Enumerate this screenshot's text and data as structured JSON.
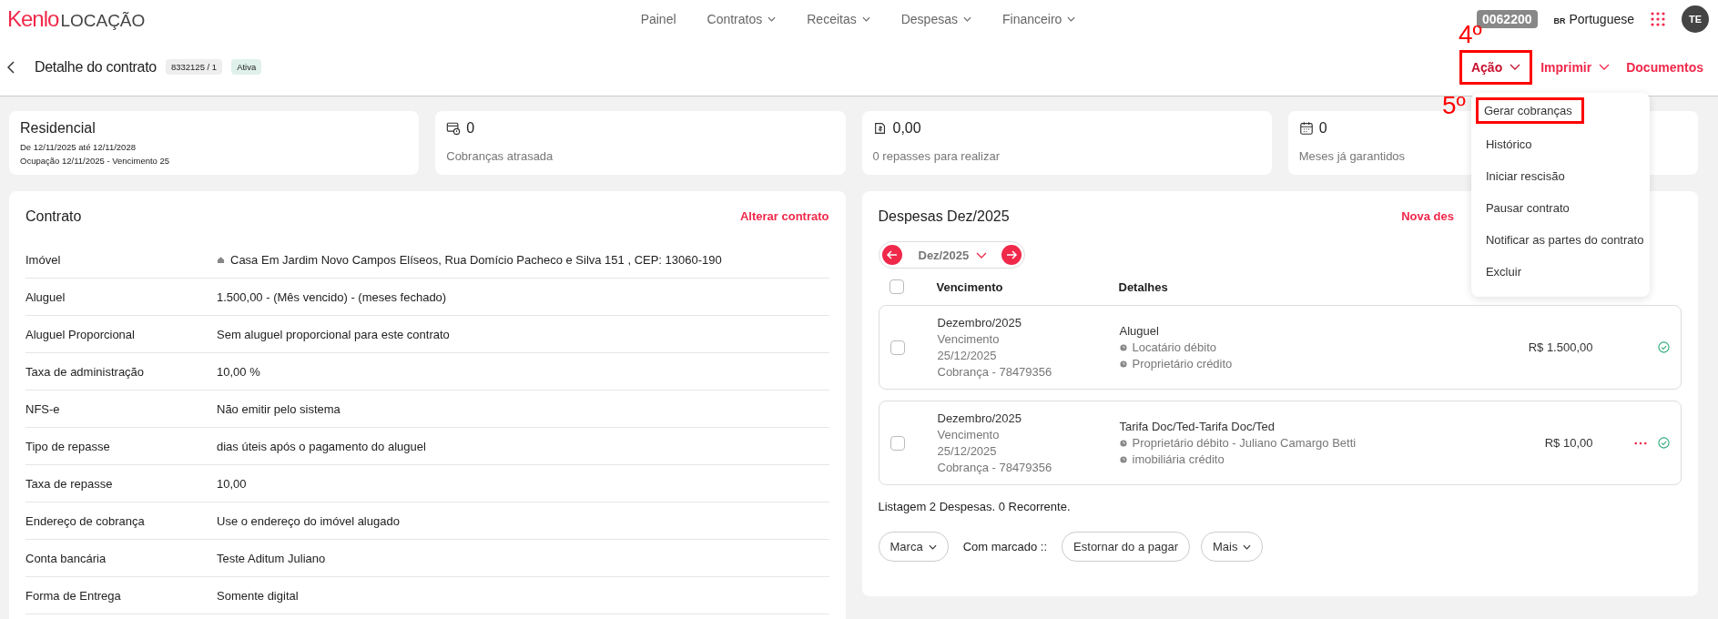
{
  "brand": {
    "logo": "Kenlo",
    "product": "LOCAÇÃO"
  },
  "nav": [
    {
      "label": "Painel",
      "dropdown": false
    },
    {
      "label": "Contratos",
      "dropdown": true
    },
    {
      "label": "Receitas",
      "dropdown": true
    },
    {
      "label": "Despesas",
      "dropdown": true
    },
    {
      "label": "Financeiro",
      "dropdown": true
    }
  ],
  "account": {
    "code": "0062200",
    "language_flag": "BR",
    "language": "Portuguese",
    "avatar": "TE"
  },
  "page": {
    "title": "Detalhe do contrato",
    "contract_id": "8332125 / 1",
    "status": "Ativa"
  },
  "actions": [
    {
      "label": "Ação",
      "dropdown": true,
      "expanded": true,
      "annotation": "4º"
    },
    {
      "label": "Imprimir",
      "dropdown": true,
      "expanded": false
    },
    {
      "label": "Documentos",
      "dropdown": false,
      "expanded": false
    }
  ],
  "action_menu": [
    {
      "label": "Gerar cobranças",
      "annotation": "5º"
    },
    {
      "label": "Histórico"
    },
    {
      "label": "Iniciar rescisão"
    },
    {
      "label": "Pausar contrato"
    },
    {
      "label": "Notificar as partes do contrato"
    },
    {
      "label": "Excluir"
    }
  ],
  "summary": {
    "type": {
      "title": "Residencial",
      "period": "De 12/11/2025 até 12/11/2028",
      "occupancy": "Ocupação 12/11/2025 - Vencimento 25"
    },
    "stats": [
      {
        "kind": "overdue",
        "value": "0",
        "label": "Cobranças atrasada"
      },
      {
        "kind": "transfer",
        "value": "0,00",
        "label": "0 repasses para realizar"
      },
      {
        "kind": "calendar",
        "value": "0",
        "label": "Meses já garantidos"
      }
    ]
  },
  "contract": {
    "title": "Contrato",
    "edit_link": "Alterar contrato",
    "fields": [
      {
        "label": "Imóvel",
        "value": "Casa Em Jardim Novo Campos Elíseos, Rua Domício Pacheco e Silva 151 , CEP: 13060-190",
        "kind": "address"
      },
      {
        "label": "Aluguel",
        "value": "1.500,00 - (Mês vencido) - (meses fechado)",
        "kind": "text"
      },
      {
        "label": "Aluguel Proporcional",
        "value": "Sem aluguel proporcional para este contrato",
        "kind": "text"
      },
      {
        "label": "Taxa de administração",
        "value": "10,00 %",
        "kind": "text"
      },
      {
        "label": "NFS-e",
        "value": "Não emitir pelo sistema",
        "kind": "text"
      },
      {
        "label": "Tipo de repasse",
        "value": "dias úteis após o pagamento do aluguel",
        "kind": "text"
      },
      {
        "label": "Taxa de repasse",
        "value": "10,00",
        "kind": "text"
      },
      {
        "label": "Endereço de cobrança",
        "value": "Use o endereço do imóvel alugado",
        "kind": "text"
      },
      {
        "label": "Conta bancária",
        "value": "Teste Aditum Juliano",
        "kind": "text"
      },
      {
        "label": "Forma de Entrega",
        "value": "Somente digital",
        "kind": "text"
      }
    ]
  },
  "expenses": {
    "title": "Despesas Dez/2025",
    "new_link": "Nova des",
    "month": "Dez/2025",
    "select_all": false,
    "columns": [
      "Vencimento",
      "Detalhes"
    ],
    "rows": [
      {
        "checked": false,
        "period": "Dezembro/2025",
        "due_label": "Vencimento",
        "due_date": "25/12/2025",
        "charge": "Cobrança - 78479356",
        "title": "Aluguel",
        "parties": [
          "Locatário débito",
          "Proprietário crédito"
        ],
        "amount": "R$ 1.500,00",
        "more": false,
        "paid": true
      },
      {
        "checked": false,
        "period": "Dezembro/2025",
        "due_label": "Vencimento",
        "due_date": "25/12/2025",
        "charge": "Cobrança - 78479356",
        "title": "Tarifa Doc/Ted-Tarifa Doc/Ted",
        "parties": [
          "Proprietário débito - Juliano Camargo Betti",
          "imobiliária crédito"
        ],
        "amount": "R$ 10,00",
        "more": true,
        "paid": true
      }
    ],
    "listing": "Listagem 2 Despesas. 0 Recorrente.",
    "bulk": {
      "mark": "Marca",
      "with_marked": "Com marcado ::",
      "revert": "Estornar do a pagar",
      "more": "Mais"
    }
  }
}
